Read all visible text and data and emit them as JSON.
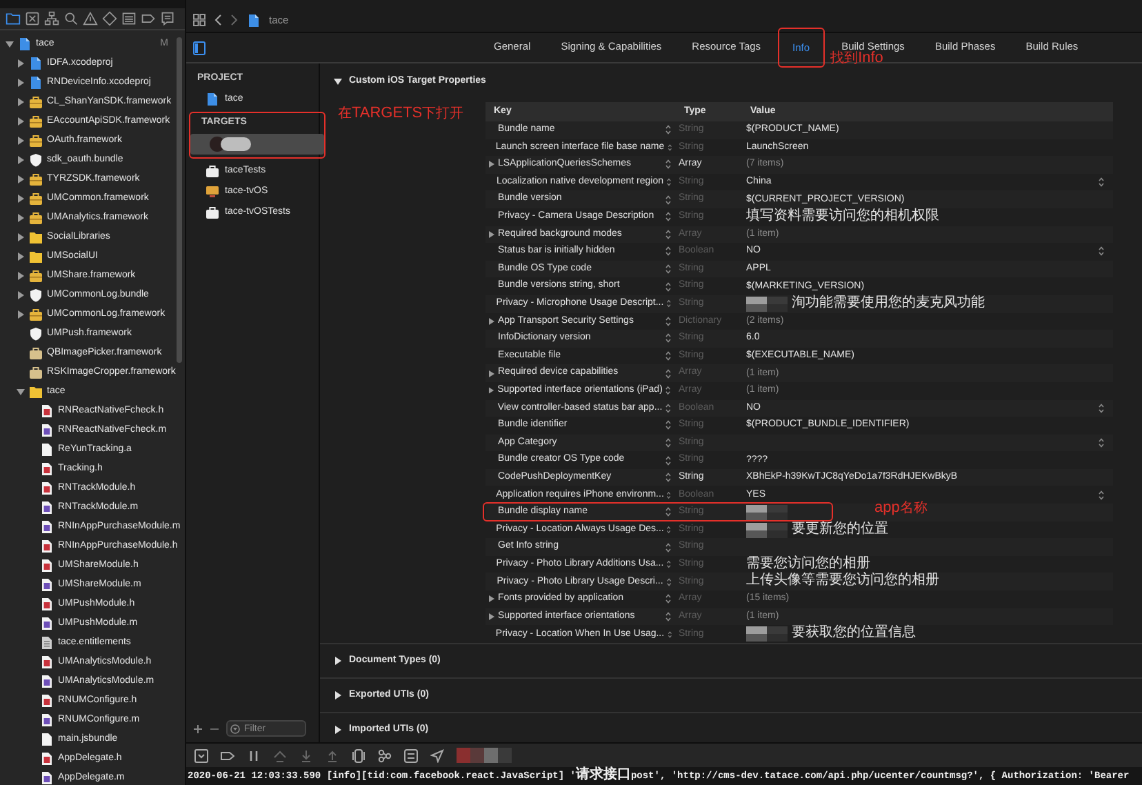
{
  "navigator": {
    "tabs": [
      {
        "kind": "folder",
        "selected": true
      },
      {
        "kind": "source",
        "selected": false
      },
      {
        "kind": "hierarchy",
        "selected": false
      },
      {
        "kind": "search",
        "selected": false
      },
      {
        "kind": "warning",
        "selected": false
      },
      {
        "kind": "test",
        "selected": false
      },
      {
        "kind": "debug",
        "selected": false
      },
      {
        "kind": "breakpoint",
        "selected": false
      },
      {
        "kind": "report",
        "selected": false
      }
    ],
    "tree": [
      {
        "name": "tace",
        "kind": "project",
        "badge": "M",
        "expanded": true,
        "children": [
          {
            "name": "IDFA.xcodeproj",
            "kind": "project",
            "expanded": false
          },
          {
            "name": "RNDeviceInfo.xcodeproj",
            "kind": "project",
            "expanded": false
          },
          {
            "name": "CL_ShanYanSDK.framework",
            "kind": "framework",
            "expanded": false
          },
          {
            "name": "EAccountApiSDK.framework",
            "kind": "framework",
            "expanded": false
          },
          {
            "name": "OAuth.framework",
            "kind": "framework",
            "expanded": false
          },
          {
            "name": "sdk_oauth.bundle",
            "kind": "bundle",
            "expanded": false
          },
          {
            "name": "TYRZSDK.framework",
            "kind": "framework",
            "expanded": false
          },
          {
            "name": "UMCommon.framework",
            "kind": "framework",
            "expanded": false
          },
          {
            "name": "UMAnalytics.framework",
            "kind": "framework",
            "expanded": false
          },
          {
            "name": "SocialLibraries",
            "kind": "folder",
            "expanded": false
          },
          {
            "name": "UMSocialUI",
            "kind": "folder",
            "expanded": false
          },
          {
            "name": "UMShare.framework",
            "kind": "framework",
            "expanded": false
          },
          {
            "name": "UMCommonLog.bundle",
            "kind": "bundle",
            "expanded": false
          },
          {
            "name": "UMCommonLog.framework",
            "kind": "framework",
            "expanded": false
          },
          {
            "name": "UMPush.framework",
            "kind": "bundle"
          },
          {
            "name": "QBImagePicker.framework",
            "kind": "package"
          },
          {
            "name": "RSKImageCropper.framework",
            "kind": "package"
          },
          {
            "name": "tace",
            "kind": "folder",
            "expanded": true,
            "children": [
              {
                "name": "RNReactNativeFcheck.h",
                "kind": "header"
              },
              {
                "name": "RNReactNativeFcheck.m",
                "kind": "impl"
              },
              {
                "name": "ReYunTracking.a",
                "kind": "file"
              },
              {
                "name": "Tracking.h",
                "kind": "header"
              },
              {
                "name": "RNTrackModule.h",
                "kind": "header"
              },
              {
                "name": "RNTrackModule.m",
                "kind": "impl"
              },
              {
                "name": "RNInAppPurchaseModule.m",
                "kind": "impl"
              },
              {
                "name": "RNInAppPurchaseModule.h",
                "kind": "header"
              },
              {
                "name": "UMShareModule.h",
                "kind": "header"
              },
              {
                "name": "UMShareModule.m",
                "kind": "impl"
              },
              {
                "name": "UMPushModule.h",
                "kind": "header"
              },
              {
                "name": "UMPushModule.m",
                "kind": "impl"
              },
              {
                "name": "tace.entitlements",
                "kind": "entitlements"
              },
              {
                "name": "UMAnalyticsModule.h",
                "kind": "header"
              },
              {
                "name": "UMAnalyticsModule.m",
                "kind": "impl"
              },
              {
                "name": "RNUMConfigure.h",
                "kind": "header"
              },
              {
                "name": "RNUMConfigure.m",
                "kind": "impl"
              },
              {
                "name": "main.jsbundle",
                "kind": "file"
              },
              {
                "name": "AppDelegate.h",
                "kind": "header"
              },
              {
                "name": "AppDelegate.m",
                "kind": "impl"
              }
            ]
          }
        ]
      }
    ]
  },
  "breadcrumb": "tace",
  "tabs": [
    {
      "label": "General",
      "selected": false,
      "annotated": false
    },
    {
      "label": "Signing & Capabilities",
      "selected": false,
      "annotated": false
    },
    {
      "label": "Resource Tags",
      "selected": false,
      "annotated": false
    },
    {
      "label": "Info",
      "selected": true,
      "annotated": true,
      "note": "找到Info"
    },
    {
      "label": "Build Settings",
      "selected": false,
      "annotated": false
    },
    {
      "label": "Build Phases",
      "selected": false,
      "annotated": false
    },
    {
      "label": "Build Rules",
      "selected": false,
      "annotated": false
    }
  ],
  "targets_panel": {
    "project_header": "PROJECT",
    "project": "tace",
    "targets_header": "TARGETS",
    "annotated": true,
    "note": "在TARGETS下打开",
    "targets": [
      {
        "redacted": true,
        "selected": true
      },
      {
        "name": "taceTests",
        "kind": "tests",
        "redacted": false,
        "selected": false
      },
      {
        "name": "tace-tvOS",
        "kind": "tv",
        "redacted": false,
        "selected": false
      },
      {
        "name": "tace-tvOSTests",
        "kind": "tests",
        "redacted": false,
        "selected": false
      }
    ],
    "filter_placeholder": "Filter"
  },
  "sections": [
    {
      "title": "Custom iOS Target Properties",
      "expanded": true,
      "table": {
        "columns": [
          "Key",
          "Type",
          "Value"
        ],
        "rows": [
          {
            "key": "Bundle name",
            "type": "String",
            "value": "$(PRODUCT_NAME)",
            "expandable": false,
            "type_dimmed": true,
            "popup": false,
            "redacted": false,
            "annotated": false
          },
          {
            "key": "Launch screen interface file base name",
            "type": "String",
            "value": "LaunchScreen",
            "expandable": false,
            "type_dimmed": true,
            "popup": false,
            "redacted": false,
            "annotated": false
          },
          {
            "key": "LSApplicationQueriesSchemes",
            "type": "Array",
            "value": "(7 items)",
            "expandable": true,
            "type_dimmed": false,
            "popup": false,
            "redacted": false,
            "annotated": false
          },
          {
            "key": "Localization native development region",
            "type": "String",
            "value": "China",
            "expandable": false,
            "type_dimmed": true,
            "popup": true,
            "redacted": false,
            "annotated": false
          },
          {
            "key": "Bundle version",
            "type": "String",
            "value": "$(CURRENT_PROJECT_VERSION)",
            "expandable": false,
            "type_dimmed": true,
            "popup": false,
            "redacted": false,
            "annotated": false
          },
          {
            "key": "Privacy - Camera Usage Description",
            "type": "String",
            "value": "填写资料需要访问您的相机权限",
            "expandable": false,
            "type_dimmed": true,
            "popup": false,
            "redacted": false,
            "annotated": false
          },
          {
            "key": "Required background modes",
            "type": "Array",
            "value": "(1 item)",
            "expandable": true,
            "type_dimmed": true,
            "popup": false,
            "redacted": false,
            "annotated": false
          },
          {
            "key": "Status bar is initially hidden",
            "type": "Boolean",
            "value": "NO",
            "expandable": false,
            "type_dimmed": true,
            "popup": true,
            "redacted": false,
            "annotated": false
          },
          {
            "key": "Bundle OS Type code",
            "type": "String",
            "value": "APPL",
            "expandable": false,
            "type_dimmed": true,
            "popup": false,
            "redacted": false,
            "annotated": false
          },
          {
            "key": "Bundle versions string, short",
            "type": "String",
            "value": "$(MARKETING_VERSION)",
            "expandable": false,
            "type_dimmed": true,
            "popup": false,
            "redacted": false,
            "annotated": false
          },
          {
            "key": "Privacy - Microphone Usage Descript...",
            "type": "String",
            "value": "洵功能需要使用您的麦克风功能",
            "expandable": false,
            "type_dimmed": true,
            "popup": false,
            "redacted": true,
            "annotated": false
          },
          {
            "key": "App Transport Security Settings",
            "type": "Dictionary",
            "value": "(2 items)",
            "expandable": true,
            "type_dimmed": true,
            "popup": false,
            "redacted": false,
            "annotated": false
          },
          {
            "key": "InfoDictionary version",
            "type": "String",
            "value": "6.0",
            "expandable": false,
            "type_dimmed": true,
            "popup": false,
            "redacted": false,
            "annotated": false
          },
          {
            "key": "Executable file",
            "type": "String",
            "value": "$(EXECUTABLE_NAME)",
            "expandable": false,
            "type_dimmed": true,
            "popup": false,
            "redacted": false,
            "annotated": false
          },
          {
            "key": "Required device capabilities",
            "type": "Array",
            "value": "(1 item)",
            "expandable": true,
            "type_dimmed": true,
            "popup": false,
            "redacted": false,
            "annotated": false
          },
          {
            "key": "Supported interface orientations (iPad)",
            "type": "Array",
            "value": "(1 item)",
            "expandable": true,
            "type_dimmed": true,
            "popup": false,
            "redacted": false,
            "annotated": false
          },
          {
            "key": "View controller-based status bar app...",
            "type": "Boolean",
            "value": "NO",
            "expandable": false,
            "type_dimmed": true,
            "popup": true,
            "redacted": false,
            "annotated": false
          },
          {
            "key": "Bundle identifier",
            "type": "String",
            "value": "$(PRODUCT_BUNDLE_IDENTIFIER)",
            "expandable": false,
            "type_dimmed": true,
            "popup": false,
            "redacted": false,
            "annotated": false
          },
          {
            "key": "App Category",
            "type": "String",
            "expandable": false,
            "type_dimmed": true,
            "popup": true,
            "redacted": false,
            "annotated": false
          },
          {
            "key": "Bundle creator OS Type code",
            "type": "String",
            "value": "????",
            "expandable": false,
            "type_dimmed": true,
            "popup": false,
            "redacted": false,
            "annotated": false
          },
          {
            "key": "CodePushDeploymentKey",
            "type": "String",
            "value": "XBhEkP-h39KwTJC8qYeDo1a7f3RdHJEKwBkyB",
            "expandable": false,
            "type_dimmed": false,
            "popup": false,
            "redacted": false,
            "annotated": false
          },
          {
            "key": "Application requires iPhone environm...",
            "type": "Boolean",
            "value": "YES",
            "expandable": false,
            "type_dimmed": true,
            "popup": true,
            "redacted": false,
            "annotated": false
          },
          {
            "key": "Bundle display name",
            "type": "String",
            "expandable": false,
            "type_dimmed": true,
            "popup": false,
            "redacted": true,
            "annotated": true,
            "note": "app名称"
          },
          {
            "key": "Privacy - Location Always Usage Des...",
            "type": "String",
            "value": "要更新您的位置",
            "expandable": false,
            "type_dimmed": true,
            "popup": false,
            "redacted": true,
            "annotated": false
          },
          {
            "key": "Get Info string",
            "type": "String",
            "expandable": false,
            "type_dimmed": true,
            "popup": false,
            "redacted": false,
            "annotated": false
          },
          {
            "key": "Privacy - Photo Library Additions Usa...",
            "type": "String",
            "value": "需要您访问您的相册",
            "expandable": false,
            "type_dimmed": true,
            "popup": false,
            "redacted": false,
            "annotated": false
          },
          {
            "key": "Privacy - Photo Library Usage Descri...",
            "type": "String",
            "value": "上传头像等需要您访问您的相册",
            "expandable": false,
            "type_dimmed": true,
            "popup": false,
            "redacted": false,
            "annotated": false
          },
          {
            "key": "Fonts provided by application",
            "type": "Array",
            "value": "(15 items)",
            "expandable": true,
            "type_dimmed": true,
            "popup": false,
            "redacted": false,
            "annotated": false
          },
          {
            "key": "Supported interface orientations",
            "type": "Array",
            "value": "(1 item)",
            "expandable": true,
            "type_dimmed": true,
            "popup": false,
            "redacted": false,
            "annotated": false
          },
          {
            "key": "Privacy - Location When In Use Usag...",
            "type": "String",
            "value": "要获取您的位置信息",
            "expandable": false,
            "type_dimmed": true,
            "popup": false,
            "redacted": true,
            "annotated": false
          }
        ]
      }
    },
    {
      "title": "Document Types (0)",
      "expanded": false
    },
    {
      "title": "Exported UTIs (0)",
      "expanded": false
    },
    {
      "title": "Imported UTIs (0)",
      "expanded": false
    }
  ],
  "debug_bar": {
    "redacted": true
  },
  "console": {
    "line": "2020-06-21 12:03:33.590 [info][tid:com.facebook.react.JavaScript] '请求接口post', 'http://cms-dev.tatace.com/api.php/ucenter/countmsg?', { Authorization: 'Bearer"
  }
}
